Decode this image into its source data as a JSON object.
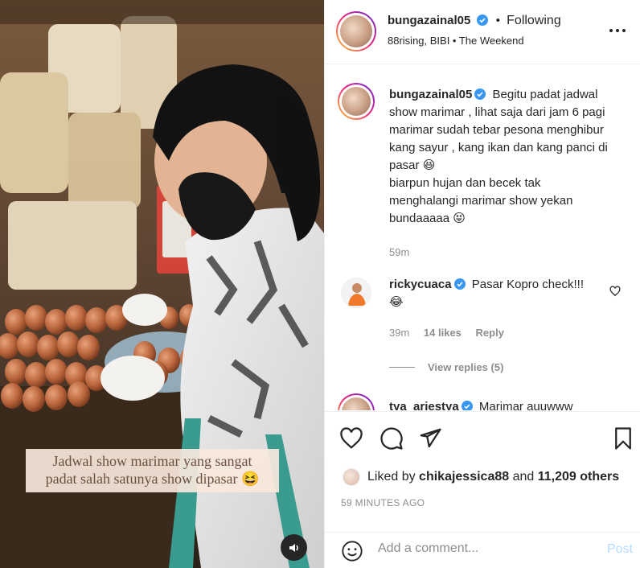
{
  "media": {
    "caption_line1": "Jadwal show marimar yang sangat",
    "caption_line2": "padat salah satunya show dipasar 😆",
    "sound_icon": "speaker-icon"
  },
  "header": {
    "username": "bungazainal05",
    "dot": "•",
    "follow_status": "Following",
    "audio": "88rising, BIBI • The Weekend",
    "more_icon": "more-horizontal-icon"
  },
  "caption": {
    "username": "bungazainal05",
    "text_lines": [
      "Begitu padat jadwal",
      "show marimar , lihat saja dari jam 6 pagi",
      "marimar sudah tebar pesona menghibur",
      "kang sayur , kang ikan dan kang panci di",
      "pasar 😆",
      "biarpun hujan dan becek tak",
      "menghalangi marimar show yekan",
      "bundaaaaa 😝"
    ],
    "time": "59m"
  },
  "comments": [
    {
      "username": "rickycuaca",
      "text": "Pasar Kopro check!!!",
      "emoji": "😂",
      "time": "39m",
      "likes": "14 likes",
      "reply": "Reply",
      "view_replies": "View replies (5)"
    },
    {
      "username": "tya_ariestya",
      "text": "Marimar auuwww"
    }
  ],
  "actions": {
    "liked_by_prefix": "Liked by",
    "liked_by_user": "chikajessica88",
    "liked_by_and": "and",
    "liked_by_others": "11,209 others",
    "timestamp": "59 MINUTES AGO"
  },
  "comment_bar": {
    "placeholder": "Add a comment...",
    "post": "Post"
  },
  "colors": {
    "link_blue": "#0095f6",
    "post_disabled": "#b3dbff",
    "secondary_text": "#8e8e8e",
    "verified": "#3897f0"
  }
}
